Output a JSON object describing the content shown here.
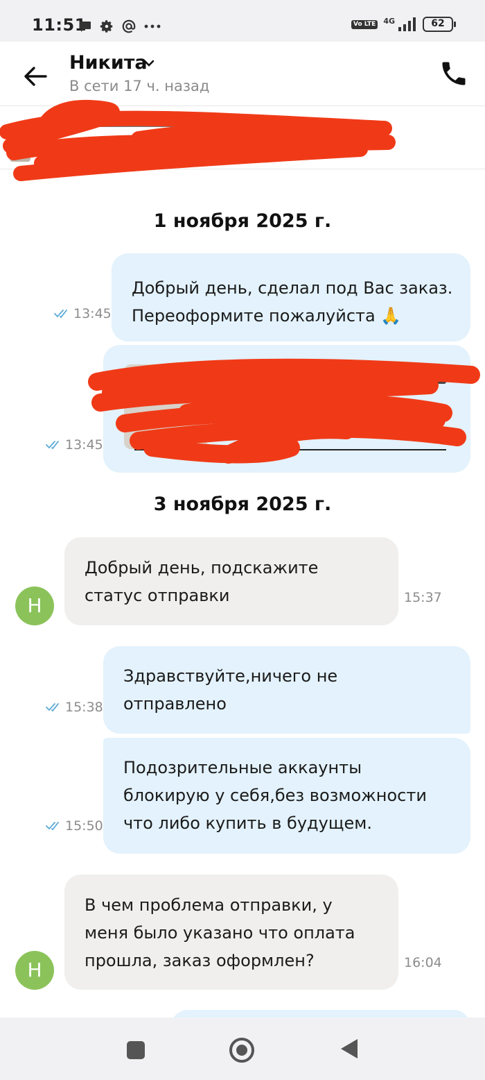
{
  "status_bar": {
    "time": "11:51",
    "volte": "Vo LTE",
    "network": "4G",
    "battery": "62"
  },
  "header": {
    "name": "Никита",
    "status": "В сети 17 ч. назад"
  },
  "chat": {
    "date_1": "1 ноября 2025 г.",
    "date_2": "3 ноября 2025 г.",
    "msg_1": {
      "line_1": "Добрый день, сделал под Вас заказ.",
      "line_2": "Переоформите пожалуйста 🙏",
      "time": "13:45"
    },
    "msg_2": {
      "time": "13:45"
    },
    "msg_3": {
      "line_1": "Добрый день, подскажите",
      "line_2": "статус отправки",
      "time": "15:37",
      "avatar": "Н"
    },
    "msg_4": {
      "line_1": "Здравствуйте,ничего не",
      "line_2": "отправлено",
      "time": "15:38"
    },
    "msg_5": {
      "line_1": "Подозрительные аккаунты",
      "line_2": "блокирую у себя,без возможности",
      "line_3": "что либо купить в будущем.",
      "time": "15:50"
    },
    "msg_6": {
      "line_1": "В чем проблема отправки, у",
      "line_2": "меня было указано что оплата",
      "line_3": "прошла, заказ оформлен?",
      "time": "16:04",
      "avatar": "Н"
    }
  },
  "colors": {
    "outgoing_bubble": "#e3f2fc",
    "incoming_bubble": "#f0efee",
    "avatar": "#8bc35a",
    "redaction": "#f03a17",
    "read_ticks": "#5aa9d6"
  }
}
